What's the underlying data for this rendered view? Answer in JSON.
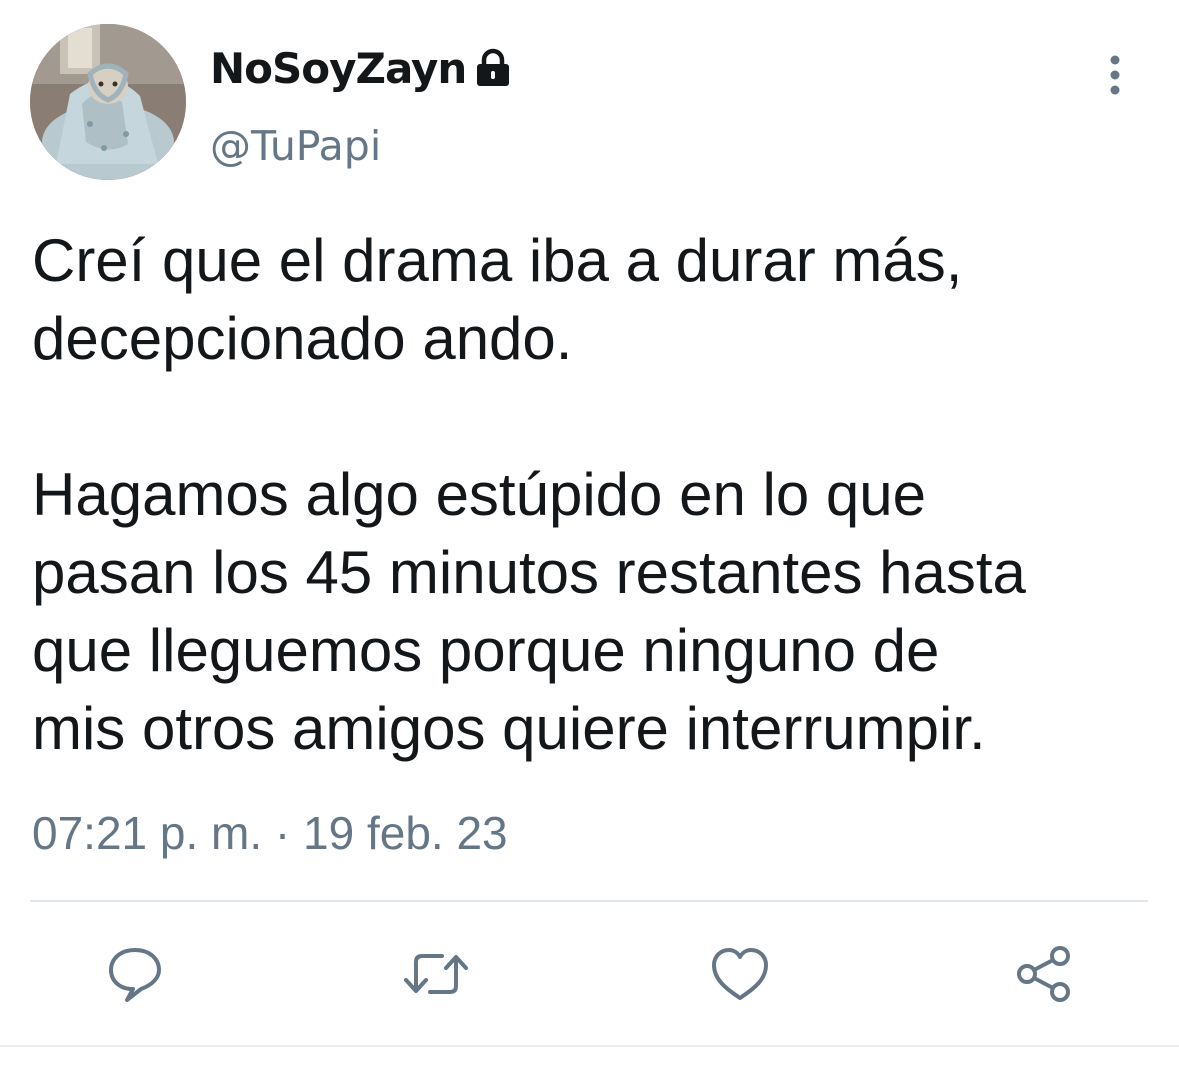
{
  "tweet": {
    "author": {
      "display_name": "NoSoyZayn",
      "handle": "@TuPapi",
      "protected_icon": "lock-icon",
      "avatar_icon": "avatar-photo"
    },
    "text_paragraphs": [
      [
        "Creí que el drama iba a durar más,",
        "decepcionado ando."
      ],
      [
        "Hagamos algo estúpido en lo que",
        "pasan los 45 minutos restantes hasta",
        "que lleguemos porque ninguno de",
        "mis otros amigos quiere interrumpir."
      ]
    ],
    "timestamp": "07:21 p. m. · 19 feb. 23",
    "actions": [
      {
        "name": "reply",
        "icon": "reply-icon"
      },
      {
        "name": "retweet",
        "icon": "retweet-icon"
      },
      {
        "name": "like",
        "icon": "heart-icon"
      },
      {
        "name": "share",
        "icon": "share-icon"
      }
    ],
    "menu_icon": "more-vertical-icon"
  },
  "colors": {
    "text_primary": "#14171a",
    "text_secondary": "#657786",
    "icon": "#657786",
    "divider": "#e1e8ed",
    "background": "#ffffff"
  }
}
